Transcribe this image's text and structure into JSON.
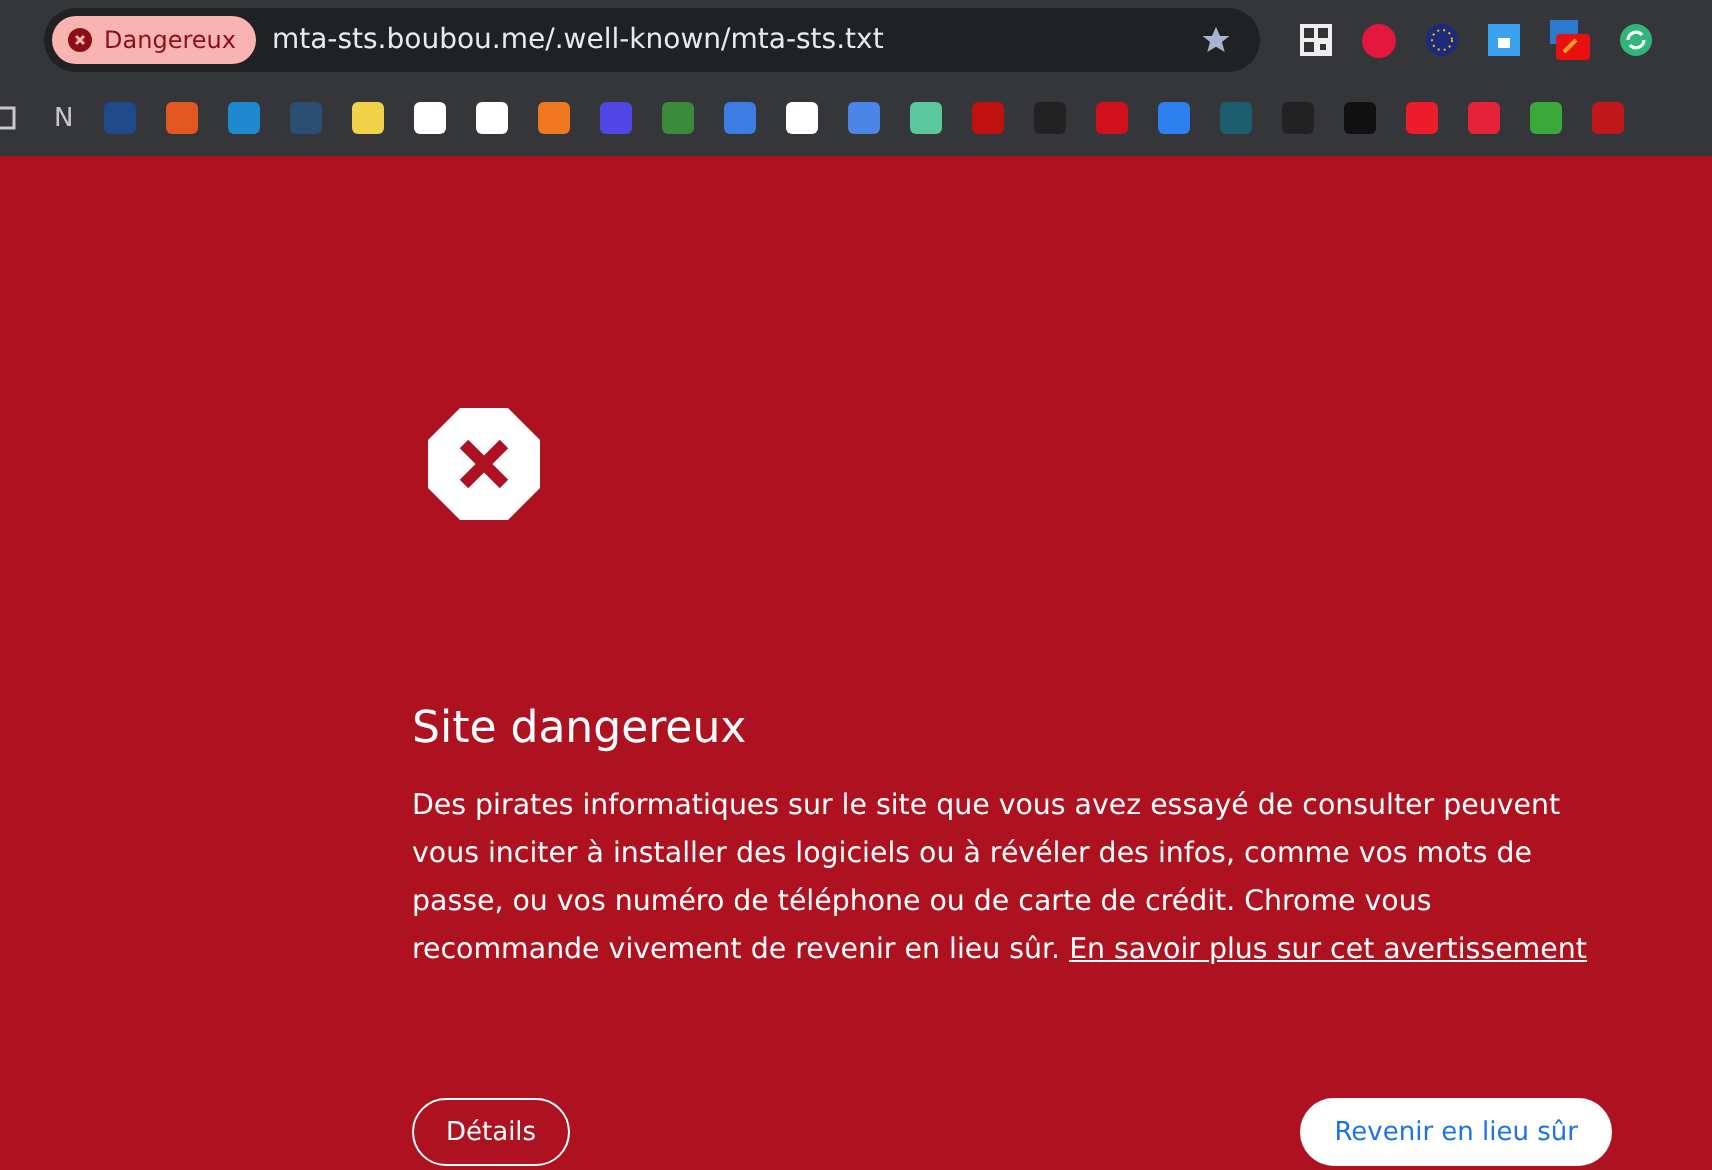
{
  "address_bar": {
    "security_chip": "Dangereux",
    "url": "mta-sts.boubou.me/.well-known/mta-sts.txt"
  },
  "bookmarks_bar": {
    "folder_label": "N"
  },
  "warning": {
    "title": "Site dangereux",
    "body": "Des pirates informatiques sur le site que vous avez essayé de consulter peuvent vous inciter à installer des logiciels ou à révéler des infos, comme vos mots de passe, ou vos numéro de téléphone ou de carte de crédit. Chrome vous recommande vivement de revenir en lieu sûr.",
    "learn_more_link": "En savoir plus sur cet avertissement"
  },
  "buttons": {
    "details": "Détails",
    "back": "Revenir en lieu sûr"
  }
}
